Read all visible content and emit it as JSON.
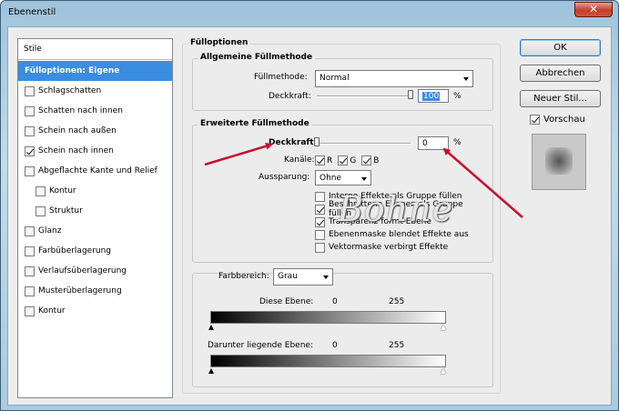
{
  "window": {
    "title": "Ebenenstil",
    "close_label": "✕"
  },
  "stylelist": {
    "header": "Stile",
    "items": [
      {
        "label": "Fülloptionen: Eigene",
        "checkbox": false,
        "checked": false,
        "selected": true,
        "indent": 0
      },
      {
        "label": "Schlagschatten",
        "checkbox": true,
        "checked": false,
        "selected": false,
        "indent": 0
      },
      {
        "label": "Schatten nach innen",
        "checkbox": true,
        "checked": false,
        "selected": false,
        "indent": 0
      },
      {
        "label": "Schein nach außen",
        "checkbox": true,
        "checked": false,
        "selected": false,
        "indent": 0
      },
      {
        "label": "Schein nach innen",
        "checkbox": true,
        "checked": true,
        "selected": false,
        "indent": 0
      },
      {
        "label": "Abgeflachte Kante und Relief",
        "checkbox": true,
        "checked": false,
        "selected": false,
        "indent": 0
      },
      {
        "label": "Kontur",
        "checkbox": true,
        "checked": false,
        "selected": false,
        "indent": 1
      },
      {
        "label": "Struktur",
        "checkbox": true,
        "checked": false,
        "selected": false,
        "indent": 1
      },
      {
        "label": "Glanz",
        "checkbox": true,
        "checked": false,
        "selected": false,
        "indent": 0
      },
      {
        "label": "Farbüberlagerung",
        "checkbox": true,
        "checked": false,
        "selected": false,
        "indent": 0
      },
      {
        "label": "Verlaufsüberlagerung",
        "checkbox": true,
        "checked": false,
        "selected": false,
        "indent": 0
      },
      {
        "label": "Musterüberlagerung",
        "checkbox": true,
        "checked": false,
        "selected": false,
        "indent": 0
      },
      {
        "label": "Kontur",
        "checkbox": true,
        "checked": false,
        "selected": false,
        "indent": 0
      }
    ]
  },
  "fill": {
    "section_title": "Fülloptionen",
    "general": {
      "title": "Allgemeine Füllmethode",
      "mode_label": "Füllmethode:",
      "mode_value": "Normal",
      "opacity_label": "Deckkraft:",
      "opacity_value": "100",
      "opacity_level": 1.0,
      "unit": "%"
    },
    "advanced": {
      "title": "Erweiterte Füllmethode",
      "opacity_label": "Deckkraft:",
      "opacity_value": "0",
      "opacity_level": 0.0,
      "unit": "%",
      "channels_label": "Kanäle:",
      "channels": [
        {
          "label": "R",
          "checked": true
        },
        {
          "label": "G",
          "checked": true
        },
        {
          "label": "B",
          "checked": true
        }
      ],
      "knockout_label": "Aussparung:",
      "knockout_value": "Ohne",
      "options": [
        {
          "label": "Interne Effekte als Gruppe füllen",
          "checked": false
        },
        {
          "label": "Beschnittene Ebenen als Gruppe füllen",
          "checked": true
        },
        {
          "label": "Transparenz formt Ebene",
          "checked": true
        },
        {
          "label": "Ebenenmaske blendet Effekte aus",
          "checked": false
        },
        {
          "label": "Vektormaske verbirgt Effekte",
          "checked": false
        }
      ]
    },
    "blend_if": {
      "label": "Farbbereich:",
      "value": "Grau",
      "this_layer_label": "Diese Ebene:",
      "this_low": "0",
      "this_high": "255",
      "underlying_label": "Darunter liegende Ebene:",
      "under_low": "0",
      "under_high": "255"
    }
  },
  "buttons": {
    "ok": "OK",
    "cancel": "Abbrechen",
    "new_style": "Neuer Stil...",
    "preview_label": "Vorschau",
    "preview_checked": true
  },
  "watermark": "Bohne",
  "colors": {
    "selection": "#3a8de0",
    "arrow": "#c8102e",
    "title_bg": "#b4d2e6"
  }
}
